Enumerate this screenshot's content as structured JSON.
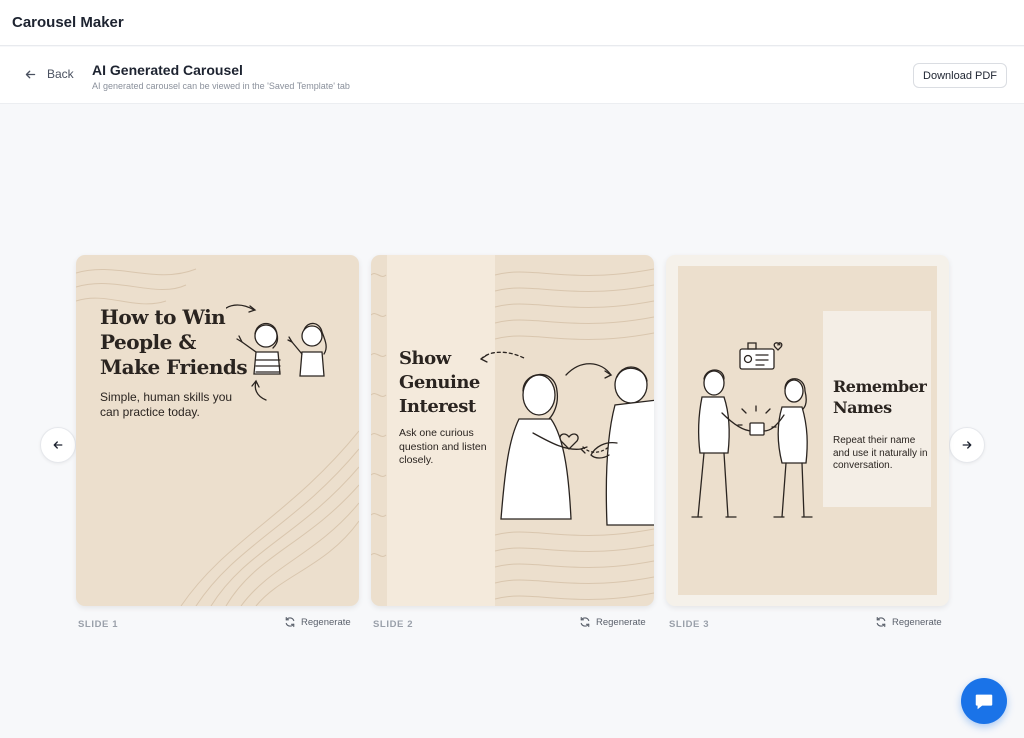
{
  "app": {
    "title": "Carousel Maker"
  },
  "header": {
    "back_label": "Back",
    "title": "AI Generated Carousel",
    "subtitle": "AI generated carousel can be viewed in the 'Saved Template' tab",
    "download_label": "Download PDF"
  },
  "slides": [
    {
      "label": "SLIDE 1",
      "regenerate_label": "Regenerate",
      "title_lines": [
        "How to Win",
        "People &",
        "Make Friends"
      ],
      "body": "Simple, human skills you can practice today."
    },
    {
      "label": "SLIDE 2",
      "regenerate_label": "Regenerate",
      "title_lines": [
        "Show",
        "Genuine",
        "Interest"
      ],
      "body": "Ask one curious question and listen closely."
    },
    {
      "label": "SLIDE 3",
      "regenerate_label": "Regenerate",
      "title_lines": [
        "Remember",
        "Names"
      ],
      "body": "Repeat their name and use it naturally in conversation."
    }
  ],
  "icons": {
    "back": "arrow-left-icon",
    "prev": "arrow-left-icon",
    "next": "arrow-right-icon",
    "regenerate": "refresh-icon",
    "chat": "chat-bubble-icon"
  },
  "colors": {
    "accent": "#1a73e8",
    "slide_bg": "#ecdfcd",
    "slide_text": "#2a2420"
  }
}
